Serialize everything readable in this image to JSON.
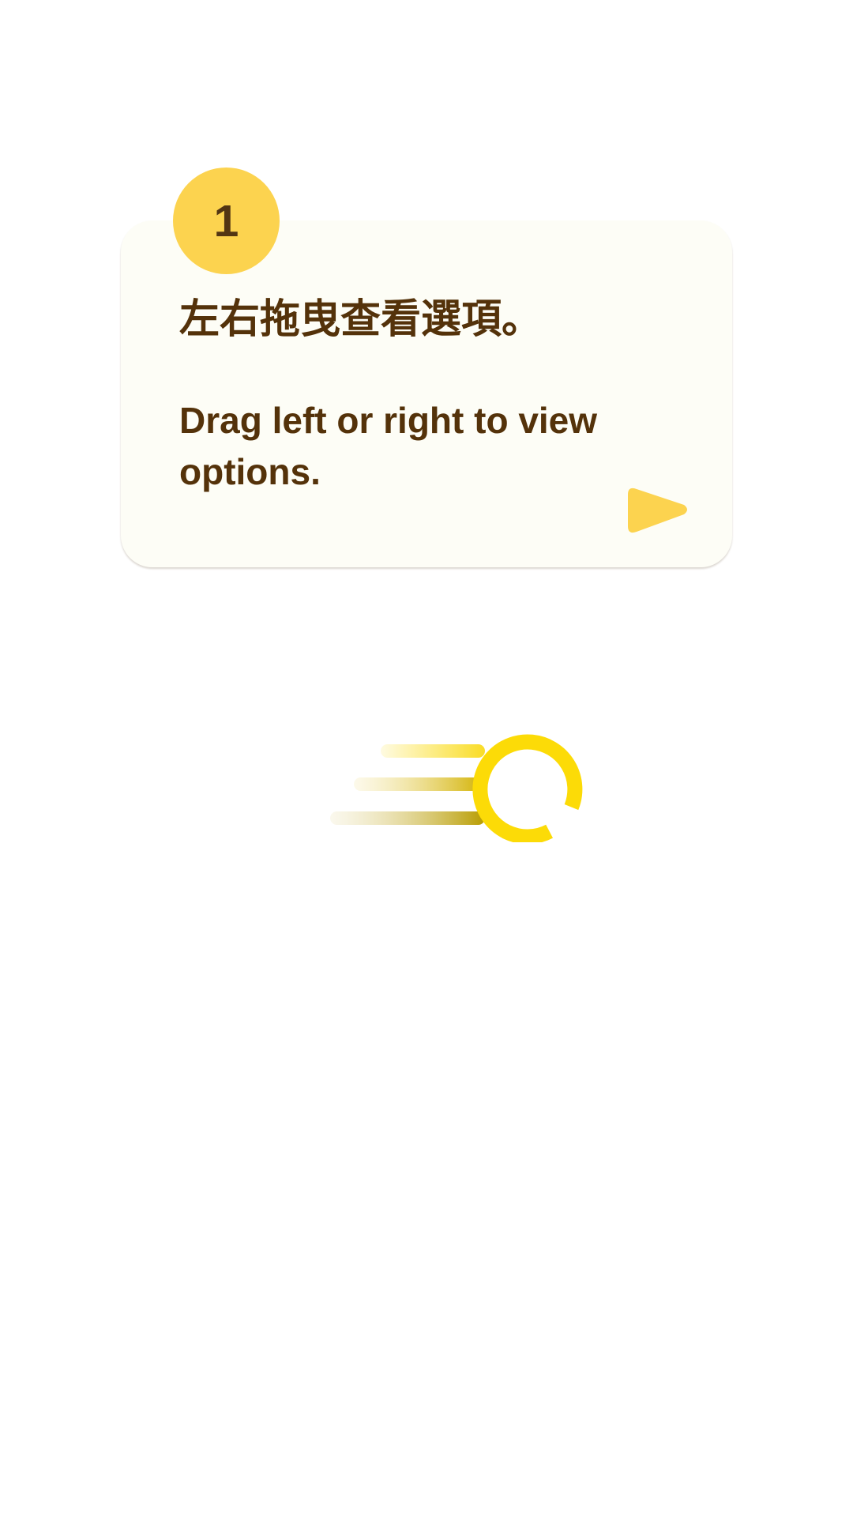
{
  "tip": {
    "step_number": "1",
    "text_zh": "左右拖曳查看選項。",
    "text_en": "Drag left or right to view options."
  },
  "icons": {
    "next": "play-triangle-icon",
    "illustration": "swipe-loading-icon"
  },
  "colors": {
    "accent": "#fcd34f",
    "text": "#54320a",
    "card_background": "#fdfdf6",
    "ring": "#fcdb07",
    "lines_dark": "#b89c00"
  }
}
